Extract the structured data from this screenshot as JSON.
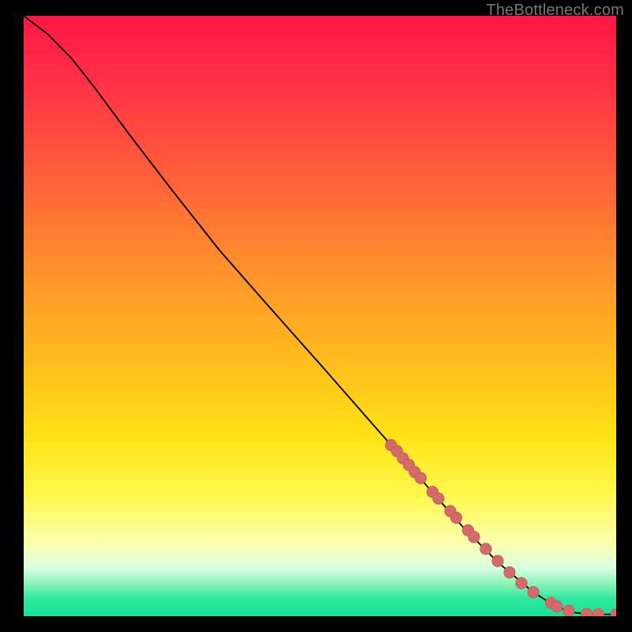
{
  "attribution": "TheBottleneck.com",
  "colors": {
    "background": "#000000",
    "gradient_stops": [
      {
        "pct": 0,
        "color": "#ff1744"
      },
      {
        "pct": 10,
        "color": "#ff2d47"
      },
      {
        "pct": 25,
        "color": "#ff5a3a"
      },
      {
        "pct": 40,
        "color": "#ff8a2e"
      },
      {
        "pct": 55,
        "color": "#ffb61f"
      },
      {
        "pct": 70,
        "color": "#ffe215"
      },
      {
        "pct": 80,
        "color": "#fff94d"
      },
      {
        "pct": 88,
        "color": "#faffb0"
      },
      {
        "pct": 92,
        "color": "#d8ffe0"
      },
      {
        "pct": 95,
        "color": "#7ef2b5"
      },
      {
        "pct": 97,
        "color": "#2fe8a0"
      },
      {
        "pct": 100,
        "color": "#19e39a"
      }
    ],
    "line": "#000000",
    "marker_fill": "#d46a6a",
    "marker_stroke": "#c45a5a"
  },
  "chart_data": {
    "type": "line",
    "title": "",
    "xlabel": "",
    "ylabel": "",
    "xlim": [
      0,
      100
    ],
    "ylim": [
      0,
      100
    ],
    "grid": false,
    "legend": false,
    "series": [
      {
        "name": "bottleneck-curve",
        "x": [
          0,
          4,
          8,
          12,
          18,
          25,
          33,
          41,
          50,
          58,
          66,
          74,
          80,
          86,
          90,
          93,
          96,
          100
        ],
        "y": [
          100,
          97,
          93,
          88,
          80,
          71,
          61,
          52,
          42,
          33,
          24,
          15,
          9,
          4,
          1.5,
          0.6,
          0.3,
          0.3
        ]
      }
    ],
    "markers": {
      "name": "data-points",
      "x": [
        62,
        63,
        64,
        65,
        66,
        67,
        69,
        70,
        72,
        73,
        75,
        76,
        78,
        80,
        82,
        84,
        86,
        89,
        90,
        92,
        95,
        97,
        100
      ],
      "y": [
        28.5,
        27.5,
        26.3,
        25.2,
        24.0,
        23.0,
        20.7,
        19.6,
        17.5,
        16.4,
        14.3,
        13.2,
        11.2,
        9.2,
        7.3,
        5.5,
        4.0,
        2.2,
        1.6,
        0.9,
        0.35,
        0.3,
        0.3
      ]
    }
  }
}
